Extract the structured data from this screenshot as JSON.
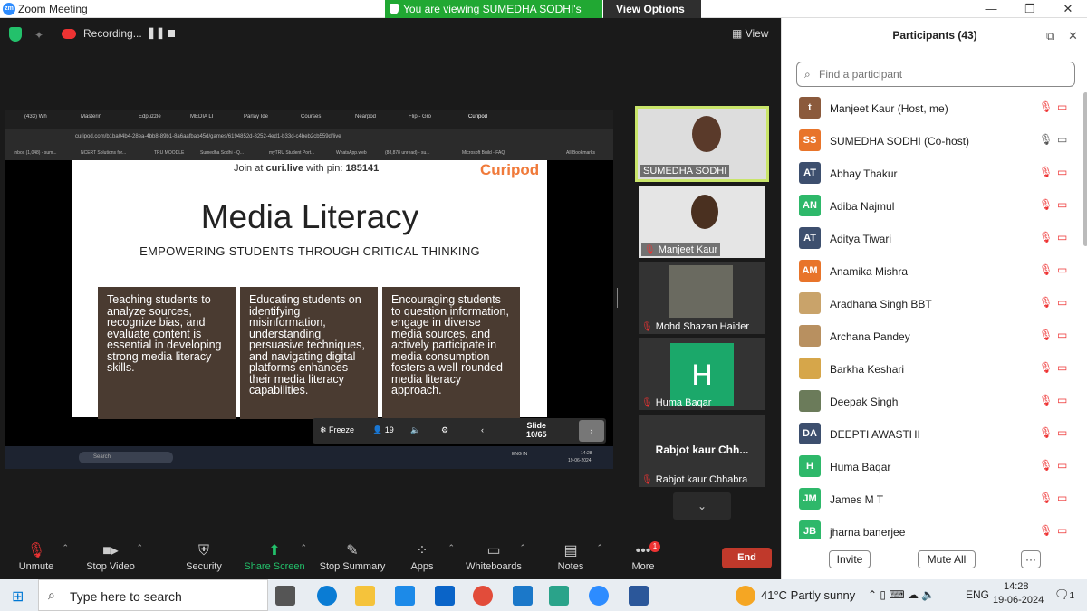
{
  "window": {
    "title": "Zoom Meeting",
    "logo": "zm"
  },
  "banner": {
    "viewing": "You are viewing SUMEDHA SODHI's screen",
    "view_options": "View Options"
  },
  "recording": {
    "label": "Recording..."
  },
  "view_button": "View",
  "shared": {
    "tabs": [
      "(433) Wh",
      "Masterin",
      "Edpuzzle",
      "MEDIA LI",
      "Parlay Ide",
      "Courses",
      "Nearpod",
      "Flip - Gro",
      "Curipod"
    ],
    "url": "curipod.com/b1ba04b4-28ea-4bb8-89b1-8a6aafbab45d/games/6194852d-8252-4ed1-b33d-c4beb2cb559d/live",
    "bookmarks": [
      "Inbox (1,048) - sum...",
      "NCERT Solutions for...",
      "TRU MOODLE",
      "Sumedha Sodhi - Q...",
      "myTRU Student Port...",
      "WhatsApp.web",
      "(88,878 unread) - su...",
      "Microsoft Build - FAQ",
      "All Bookmarks"
    ],
    "slide": {
      "join_prefix": "Join at ",
      "join_site": "curi.live",
      "join_mid": " with pin: ",
      "pin": "185141",
      "brand": "Curipod",
      "title": "Media Literacy",
      "subtitle": "EMPOWERING STUDENTS THROUGH CRITICAL THINKING",
      "cards": [
        "Teaching students to analyze sources, recognize bias, and evaluate content is essential in developing strong media literacy skills.",
        "Educating students on identifying misinformation, understanding persuasive techniques, and navigating digital platforms enhances their media literacy capabilities.",
        "Encouraging students to question information, engage in diverse media sources, and actively participate in media consumption fosters a well-rounded media literacy approach."
      ]
    },
    "pod_bar": {
      "freeze": "Freeze",
      "count": "19",
      "slide_label": "Slide",
      "slide_num": "10/65"
    },
    "inner_taskbar": {
      "search": "Search",
      "lang": "ENG IN",
      "time": "14:28",
      "date": "19-06-2024"
    }
  },
  "video_tiles": [
    {
      "name": "SUMEDHA SODHI"
    },
    {
      "name": "Manjeet Kaur"
    },
    {
      "name": "Mohd Shazan Haider"
    },
    {
      "name": "Huma Baqar",
      "initial": "H"
    },
    {
      "name": "Rabjot kaur Chhabra",
      "big_name": "Rabjot kaur Chh..."
    }
  ],
  "toolbar": {
    "unmute": "Unmute",
    "stop_video": "Stop Video",
    "security": "Security",
    "share_screen": "Share Screen",
    "stop_summary": "Stop Summary",
    "apps": "Apps",
    "whiteboards": "Whiteboards",
    "notes": "Notes",
    "more": "More",
    "more_badge": "1",
    "end": "End"
  },
  "participants": {
    "title": "Participants (43)",
    "search_placeholder": "Find a participant",
    "list": [
      {
        "initials": "t",
        "name": "Manjeet Kaur (Host, me)",
        "color": "#8b5a3c"
      },
      {
        "initials": "SS",
        "name": "SUMEDHA SODHI (Co-host)",
        "color": "#e8742a"
      },
      {
        "initials": "AT",
        "name": "Abhay Thakur",
        "color": "#3d4f6e"
      },
      {
        "initials": "AN",
        "name": "Adiba Najmul",
        "color": "#2eb86a"
      },
      {
        "initials": "AT",
        "name": "Aditya Tiwari",
        "color": "#3d4f6e"
      },
      {
        "initials": "AM",
        "name": "Anamika Mishra",
        "color": "#e8742a"
      },
      {
        "initials": "",
        "name": "Aradhana Singh BBT",
        "color": "#c9a36a"
      },
      {
        "initials": "",
        "name": "Archana Pandey",
        "color": "#b89060"
      },
      {
        "initials": "",
        "name": "Barkha Keshari",
        "color": "#d6a64a"
      },
      {
        "initials": "",
        "name": "Deepak Singh",
        "color": "#6b7b5a"
      },
      {
        "initials": "DA",
        "name": "DEEPTI AWASTHI",
        "color": "#3d4f6e"
      },
      {
        "initials": "H",
        "name": "Huma Baqar",
        "color": "#2eb86a"
      },
      {
        "initials": "JM",
        "name": "James M T",
        "color": "#2eb86a"
      },
      {
        "initials": "JB",
        "name": "jharna banerjee",
        "color": "#2eb86a"
      }
    ],
    "invite": "Invite",
    "mute_all": "Mute All",
    "more": "···"
  },
  "taskbar": {
    "search": "Type here to search",
    "weather": "41°C  Partly sunny",
    "lang": "ENG",
    "time": "14:28",
    "date": "19-06-2024",
    "notif": "1"
  }
}
